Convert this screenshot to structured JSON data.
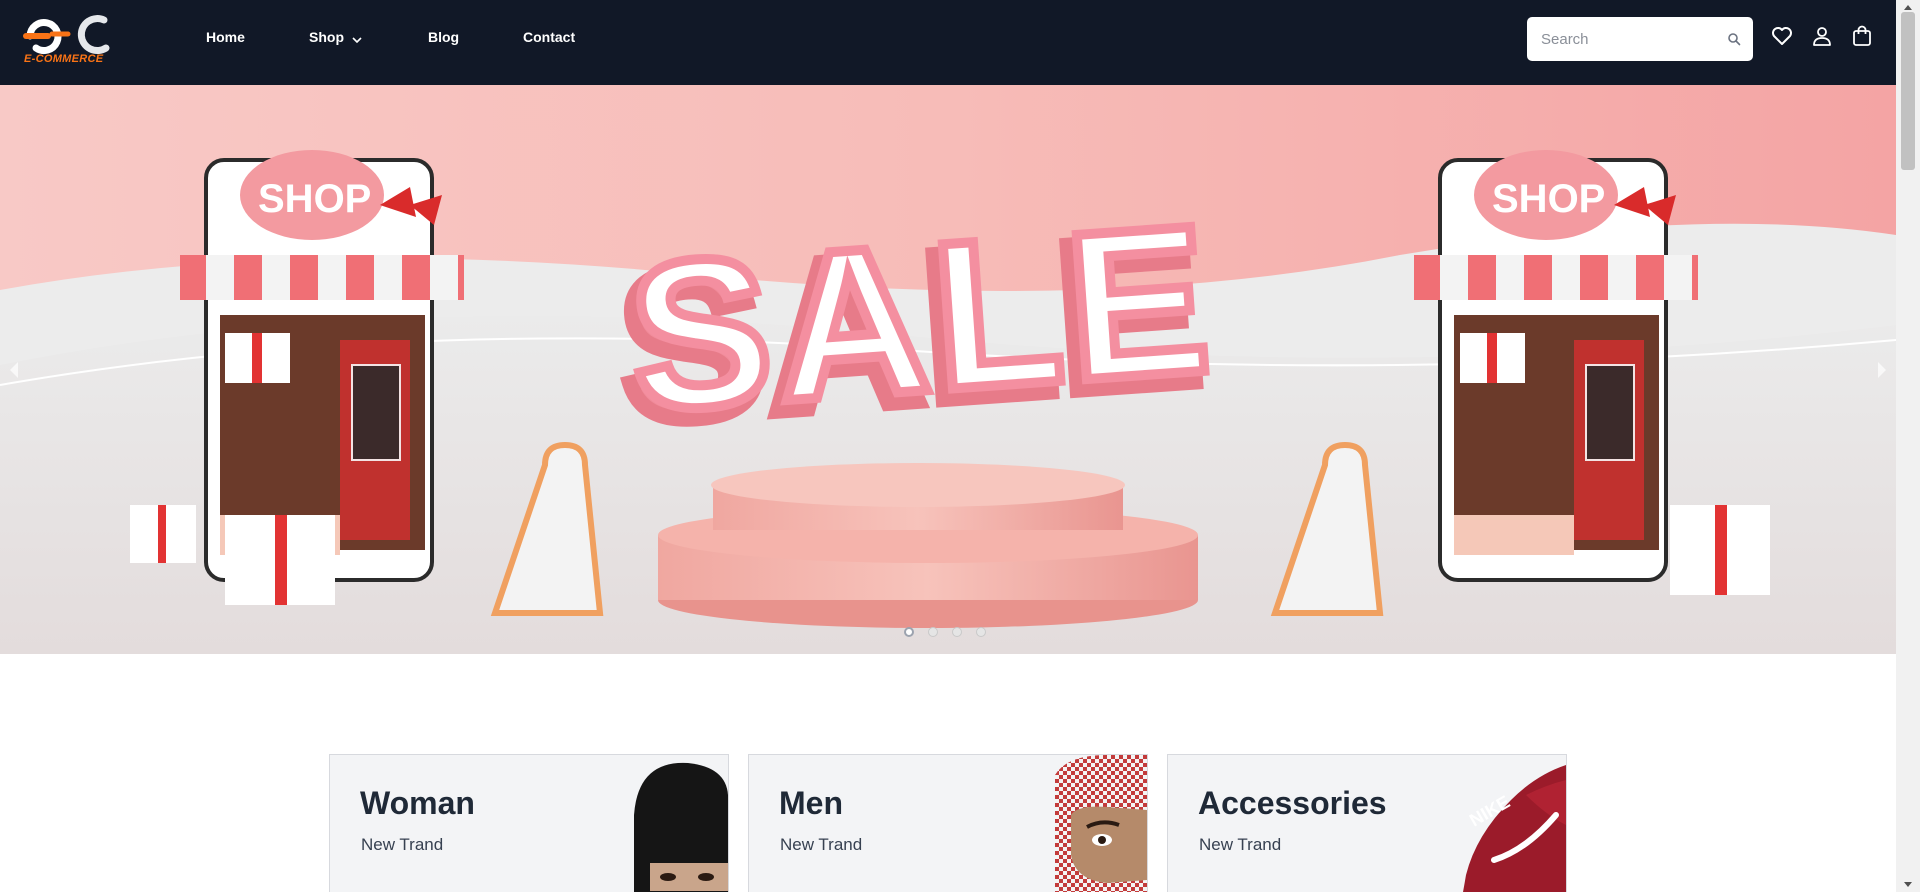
{
  "brand": {
    "logo_text": "E-COMMERCE",
    "logo_mark": "e-C"
  },
  "nav": {
    "items": [
      {
        "label": "Home"
      },
      {
        "label": "Shop"
      },
      {
        "label": "Blog"
      },
      {
        "label": "Contact"
      }
    ]
  },
  "search": {
    "placeholder": "Search",
    "value": ""
  },
  "header_icons": [
    "heart-icon",
    "user-icon",
    "shopping-bag-icon"
  ],
  "hero": {
    "shop_sign": "SHOP",
    "headline": "SALE",
    "slides_total": 4,
    "active_slide": 1
  },
  "categories": [
    {
      "title": "Woman",
      "subtitle": "New Trand"
    },
    {
      "title": "Men",
      "subtitle": "New Trand"
    },
    {
      "title": "Accessories",
      "subtitle": "New Trand"
    }
  ],
  "colors": {
    "navbar_bg": "#111827",
    "hero_pink": "#f5a5a5",
    "card_bg": "#f3f4f6",
    "logo_orange": "#f97316"
  }
}
